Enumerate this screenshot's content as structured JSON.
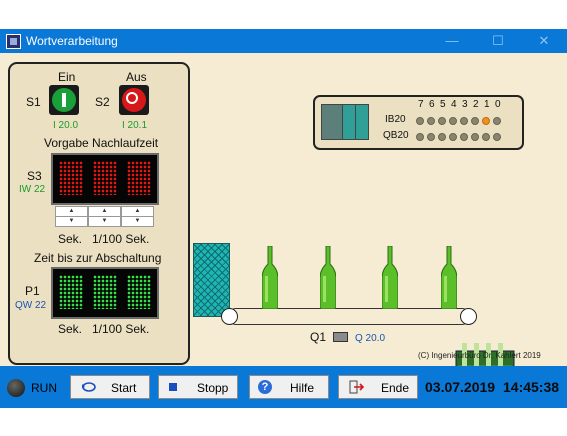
{
  "window": {
    "title": "Wortverarbeitung",
    "controls": {
      "minimize": "—",
      "maximize": "☐",
      "close": "✕"
    }
  },
  "panel": {
    "on_label": "Ein",
    "off_label": "Aus",
    "s1_label": "S1",
    "s2_label": "S2",
    "s1_addr": "I 20.0",
    "s2_addr": "I 20.1",
    "preset_title": "Vorgabe Nachlaufzeit",
    "s3_label": "S3",
    "s3_addr": "IW 22",
    "preset_digits": [
      "0",
      "0",
      "0"
    ],
    "units_sec": "Sek.",
    "units_hundredth": "1/100 Sek.",
    "remaining_title": "Zeit bis zur Abschaltung",
    "p1_label": "P1",
    "p1_addr": "QW 22",
    "remaining_digits": [
      "0",
      "0",
      "0"
    ]
  },
  "plc": {
    "bit_numbers": [
      "7",
      "6",
      "5",
      "4",
      "3",
      "2",
      "1",
      "0"
    ],
    "ib_label": "IB20",
    "qb_label": "QB20",
    "ib_bits": [
      0,
      0,
      0,
      0,
      0,
      0,
      1,
      0
    ],
    "qb_bits": [
      0,
      0,
      0,
      0,
      0,
      0,
      0,
      0
    ]
  },
  "conveyor": {
    "motor_label": "Q1",
    "motor_addr": "Q 20.0",
    "bottle_count": 4
  },
  "copyright": "(C) Ingenieurbüro Dr. Kahlert 2019",
  "bottom": {
    "run_label": "RUN",
    "start_label": "Start",
    "stop_label": "Stopp",
    "help_label": "Hilfe",
    "end_label": "Ende",
    "date": "03.07.2019",
    "time": "14:45:38"
  },
  "colors": {
    "accent": "#0a78d7",
    "panel_bg": "#ebe0c1",
    "green_led": "#36e04a",
    "red_led": "#e01818"
  }
}
